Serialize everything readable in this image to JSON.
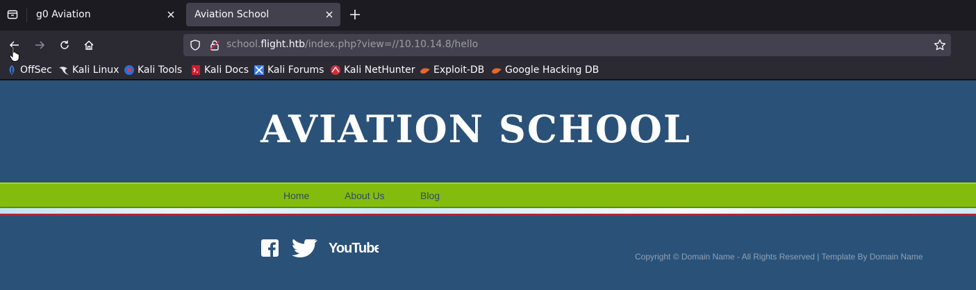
{
  "browser": {
    "tabs": [
      {
        "title": "g0 Aviation",
        "active": false
      },
      {
        "title": "Aviation School",
        "active": true
      }
    ],
    "url": {
      "prefix": "school.",
      "host": "flight.htb",
      "path": "/index.php?view=//10.10.14.8/hello"
    },
    "bookmarks": [
      {
        "label": "OffSec",
        "icon": "offsec-icon"
      },
      {
        "label": "Kali Linux",
        "icon": "kali-dragon-icon"
      },
      {
        "label": "Kali Tools",
        "icon": "kali-tools-icon"
      },
      {
        "label": "Kali Docs",
        "icon": "kali-docs-icon"
      },
      {
        "label": "Kali Forums",
        "icon": "kali-forums-icon"
      },
      {
        "label": "Kali NetHunter",
        "icon": "kali-nethunter-icon"
      },
      {
        "label": "Exploit-DB",
        "icon": "exploit-db-icon"
      },
      {
        "label": "Google Hacking DB",
        "icon": "ghdb-icon"
      }
    ]
  },
  "site": {
    "title": "AVIATION SCHOOL",
    "menu": [
      "Home",
      "About Us",
      "Blog"
    ],
    "social": [
      "facebook-icon",
      "twitter-icon",
      "youtube-icon"
    ],
    "youtube_label": "YouTube",
    "copyright": "Copyright © Domain Name - All Rights Reserved | Template By Domain Name"
  },
  "colors": {
    "header_bg": "#2a5178",
    "menu_bg": "#84bc0e",
    "accent_red": "#b3262b"
  }
}
